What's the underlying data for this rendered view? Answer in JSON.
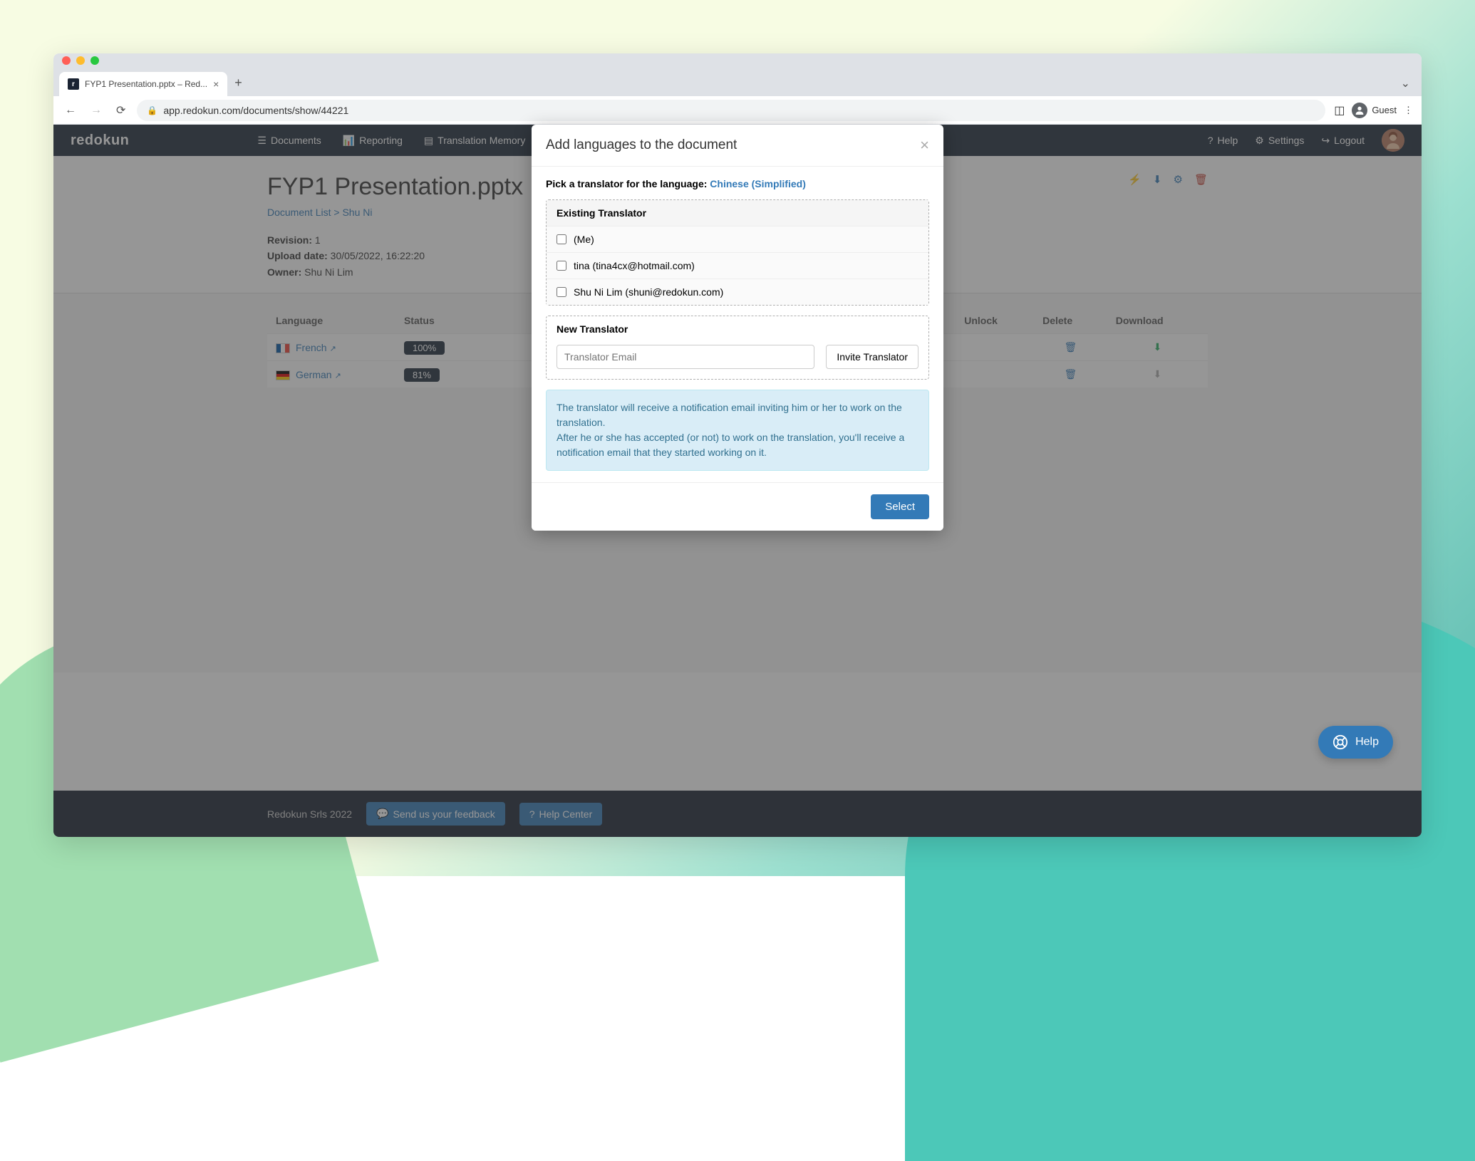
{
  "browser": {
    "tab_title": "FYP1 Presentation.pptx – Red...",
    "url": "app.redokun.com/documents/show/44221",
    "guest_label": "Guest"
  },
  "nav": {
    "brand": "redokun",
    "documents": "Documents",
    "reporting": "Reporting",
    "tm": "Translation Memory",
    "help": "Help",
    "settings": "Settings",
    "logout": "Logout"
  },
  "doc": {
    "title": "FYP1 Presentation.pptx",
    "breadcrumb_list": "Document List",
    "breadcrumb_sep": ">",
    "breadcrumb_current": "Shu Ni",
    "revision_label": "Revision:",
    "revision_value": "1",
    "upload_label": "Upload date:",
    "upload_value": "30/05/2022, 16:22:20",
    "owner_label": "Owner:",
    "owner_value": "Shu Ni Lim"
  },
  "table": {
    "cols": {
      "language": "Language",
      "status": "Status",
      "unlock": "Unlock",
      "delete": "Delete",
      "download": "Download"
    },
    "rows": [
      {
        "flag": "fr",
        "name": "French",
        "status": "100%"
      },
      {
        "flag": "de",
        "name": "German",
        "status": "81%"
      }
    ]
  },
  "footer": {
    "copyright": "Redokun Srls 2022",
    "feedback": "Send us your feedback",
    "helpcenter": "Help Center"
  },
  "modal": {
    "title": "Add languages to the document",
    "picker_prefix": "Pick a translator for the language:",
    "picker_lang": "Chinese (Simplified)",
    "existing_title": "Existing Translator",
    "translators": [
      "(Me)",
      "tina (tina4cx@hotmail.com)",
      "Shu Ni Lim (shuni@redokun.com)"
    ],
    "new_title": "New Translator",
    "email_placeholder": "Translator Email",
    "invite_label": "Invite Translator",
    "info1": "The translator will receive a notification email inviting him or her to work on the translation.",
    "info2": "After he or she has accepted (or not) to work on the translation, you'll receive a notification email that they started working on it.",
    "select": "Select"
  },
  "fab": {
    "help": "Help"
  }
}
